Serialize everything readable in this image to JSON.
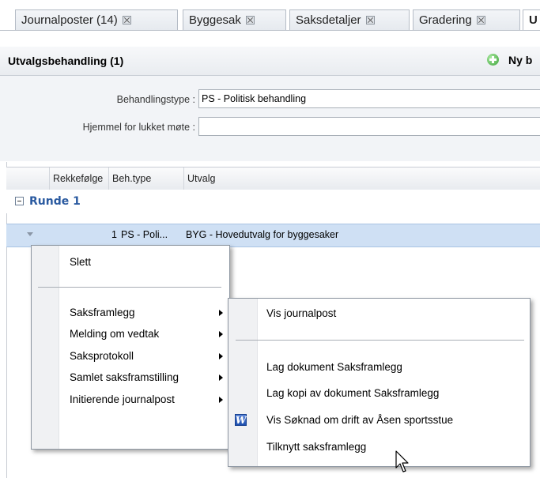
{
  "tabs": [
    {
      "label": "Journalposter (14)"
    },
    {
      "label": "Byggesak"
    },
    {
      "label": "Saksdetaljer"
    },
    {
      "label": "Gradering"
    },
    {
      "label": "U"
    }
  ],
  "header": {
    "title": "Utvalgsbehandling (1)",
    "new_button": "Ny b"
  },
  "form": {
    "behandlingstype_label": "Behandlingstype :",
    "behandlingstype_value": "PS - Politisk behandling",
    "hjemmel_label": "Hjemmel for lukket møte :",
    "hjemmel_value": ""
  },
  "grid": {
    "columns": [
      "Rekkefølge",
      "Beh.type",
      "Utvalg"
    ],
    "group": "Runde 1",
    "row": {
      "rekkefolge": "1",
      "behtype": "PS - Poli...",
      "utvalg": "BYG - Hovedutvalg for byggesaker"
    }
  },
  "context_menu": {
    "items": [
      {
        "label": "Slett",
        "submenu": false
      },
      {
        "label": "Saksframlegg",
        "submenu": true
      },
      {
        "label": "Melding om vedtak",
        "submenu": true
      },
      {
        "label": "Saksprotokoll",
        "submenu": true
      },
      {
        "label": "Samlet saksframstilling",
        "submenu": true
      },
      {
        "label": "Initierende journalpost",
        "submenu": true
      }
    ]
  },
  "submenu": {
    "items": [
      {
        "label": "Vis journalpost"
      },
      {
        "label": "Lag dokument Saksframlegg"
      },
      {
        "label": "Lag kopi av dokument Saksframlegg"
      },
      {
        "label": "Vis Søknad om drift av Åsen sportsstue",
        "icon": "word-icon"
      },
      {
        "label": "Tilknytt saksframlegg"
      }
    ]
  },
  "colors": {
    "selected_row": "#cfe0f4",
    "group_text": "#2a5aa0"
  }
}
